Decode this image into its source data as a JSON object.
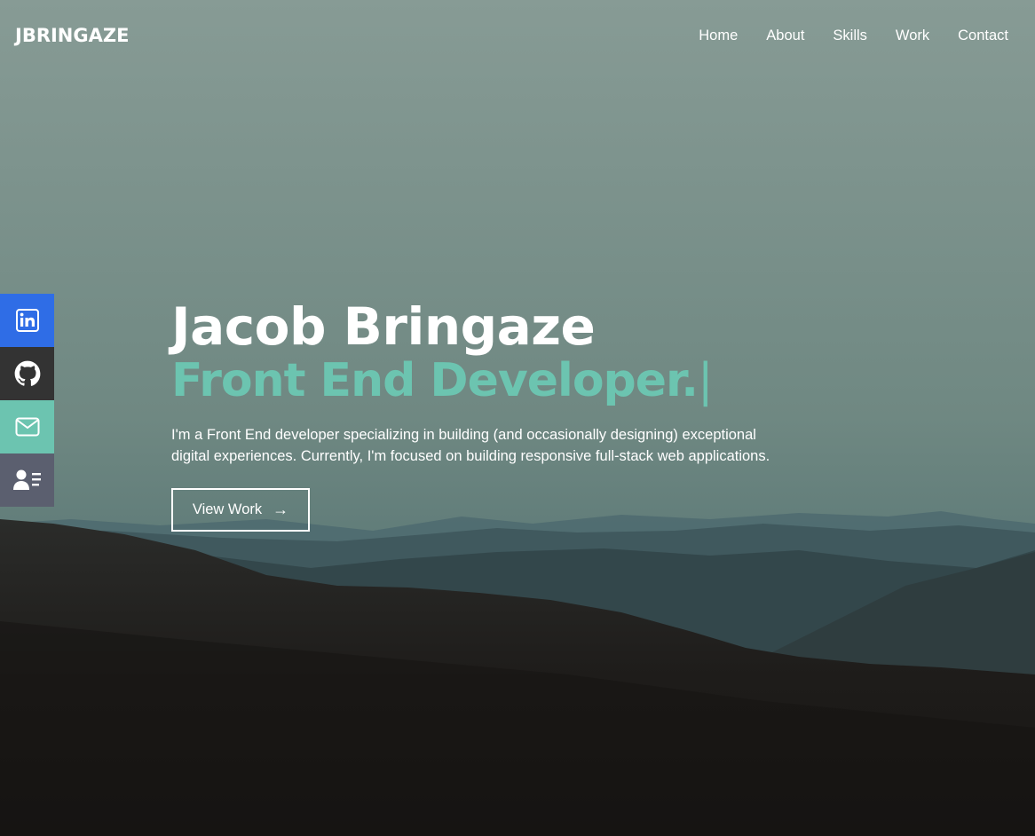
{
  "brand": "JBRINGAZE",
  "nav": {
    "items": [
      "Home",
      "About",
      "Skills",
      "Work",
      "Contact"
    ]
  },
  "social": [
    {
      "name": "linkedin",
      "icon": "linkedin-icon",
      "color": "#2f6de6"
    },
    {
      "name": "github",
      "icon": "github-icon",
      "color": "#333333"
    },
    {
      "name": "email",
      "icon": "mail-icon",
      "color": "#6cc4b0"
    },
    {
      "name": "resume",
      "icon": "resume-icon",
      "color": "#5b5f6f"
    }
  ],
  "hero": {
    "name": "Jacob Bringaze",
    "role": "Front End Developer.",
    "cursor": "|",
    "description": "I'm a Front End developer specializing in building (and occasionally designing) exceptional digital experiences. Currently, I'm focused on building responsive full-stack web applications.",
    "cta_label": "View Work",
    "cta_icon": "arrow-right-icon"
  },
  "colors": {
    "accent": "#6cc4b0",
    "text": "#ffffff"
  }
}
